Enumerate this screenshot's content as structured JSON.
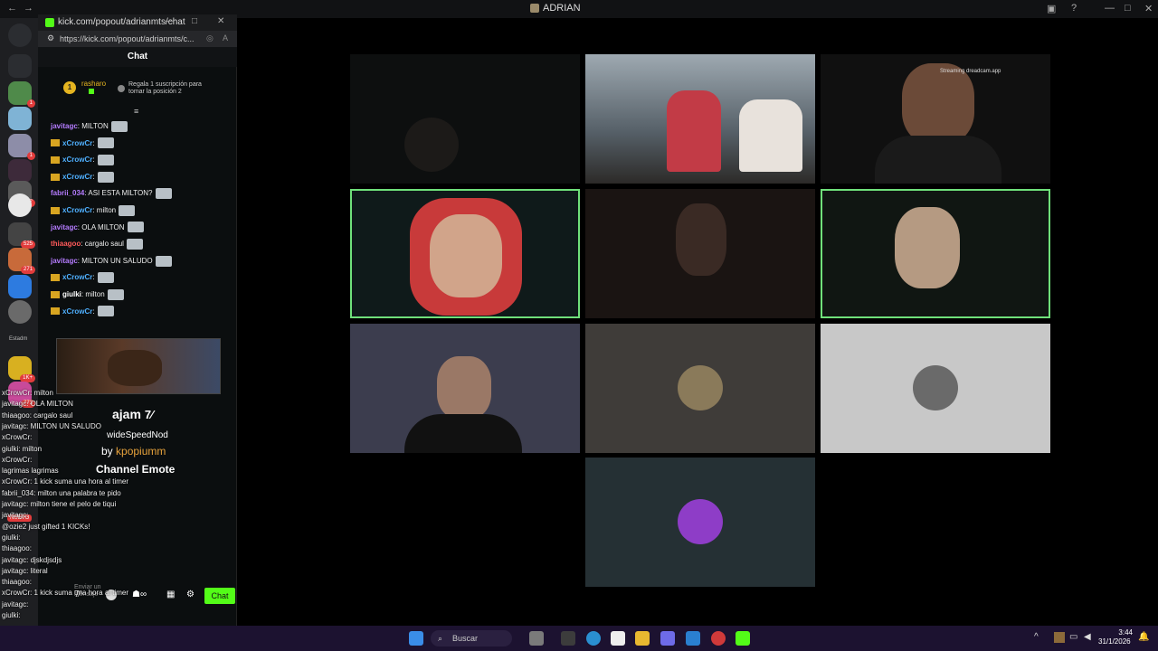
{
  "topbar": {
    "title": "ADRIAN"
  },
  "popout": {
    "window_title": "kick.com/popout/adrianmts/chat",
    "url": "https://kick.com/popout/adrianmts/c...",
    "chat_header": "Chat",
    "pinned": {
      "user": "rasharo",
      "rank": "1",
      "text": "Regala 1 suscripción para tomar la posición 2"
    },
    "messages": [
      {
        "user": "javitagc",
        "color": "#b57cff",
        "text": ": MILTON",
        "crown": false
      },
      {
        "user": "xCrowCr",
        "color": "#4fb0ff",
        "text": ":",
        "crown": true
      },
      {
        "user": "xCrowCr",
        "color": "#4fb0ff",
        "text": ":",
        "crown": true
      },
      {
        "user": "xCrowCr",
        "color": "#4fb0ff",
        "text": ":",
        "crown": true
      },
      {
        "user": "fabrii_034",
        "color": "#b57cff",
        "text": ": ASI ESTA MILTON?",
        "crown": false
      },
      {
        "user": "xCrowCr",
        "color": "#4fb0ff",
        "text": ": milton",
        "crown": true
      },
      {
        "user": "javitagc",
        "color": "#b57cff",
        "text": ": OLA MILTON",
        "crown": false
      },
      {
        "user": "thiaagoo",
        "color": "#ff5a5a",
        "text": ": cargalo saul",
        "crown": false
      },
      {
        "user": "javitagc",
        "color": "#b57cff",
        "text": ": MILTON UN SALUDO",
        "crown": false
      },
      {
        "user": "xCrowCr",
        "color": "#4fb0ff",
        "text": ":",
        "crown": true
      },
      {
        "user": "giulki",
        "color": "#ffffff",
        "text": ": milton",
        "crown": true
      },
      {
        "user": "xCrowCr",
        "color": "#4fb0ff",
        "text": ":",
        "crown": true
      }
    ],
    "emote_popup": {
      "name": "ajam",
      "variant": "wideSpeedNod",
      "by_label": "by",
      "author": "kpopiumm",
      "kind": "Channel Emote"
    },
    "overlay_lines": [
      "xCrowCr: milton",
      "javitagc: OLA MILTON",
      "thiaagoo: cargalo saul",
      "javitagc: MILTON UN SALUDO",
      "xCrowCr:",
      "giulki: milton",
      "xCrowCr:",
      "lagrimas lagrimas",
      "xCrowCr: 1 kick suma una hora al timer",
      "fabrii_034: milton una palabra te pido",
      "javitagc: milton tiene el pelo de tiqui",
      "javitagc:",
      "@ozie2 just gifted 1 KICKs!",
      "giulki:",
      "thiaagoo:",
      "javitagc: djskdjsdjs",
      "javitagc: literal",
      "thiaagoo:",
      "xCrowCr: 1 kick suma una hora al timer",
      "javitagc:",
      "giulki:"
    ],
    "nuevo_badge": "NUEVO",
    "send_placeholder": "Enviar un mensaje",
    "chat_button": "Chat"
  },
  "rail": {
    "label_estadm": "Estadm",
    "badges": [
      "1",
      "1",
      "367",
      "525",
      "271",
      "1K+",
      "773"
    ]
  },
  "overlay_name_small": "Streaming dreadcam.app",
  "taskbar": {
    "search": "Buscar",
    "time": "3:44",
    "date": "31/1/2026"
  },
  "colors": {
    "accent_green": "#53fc18",
    "tile_highlight": "#6fe07a",
    "taskbar_bg": "#1c1230"
  }
}
